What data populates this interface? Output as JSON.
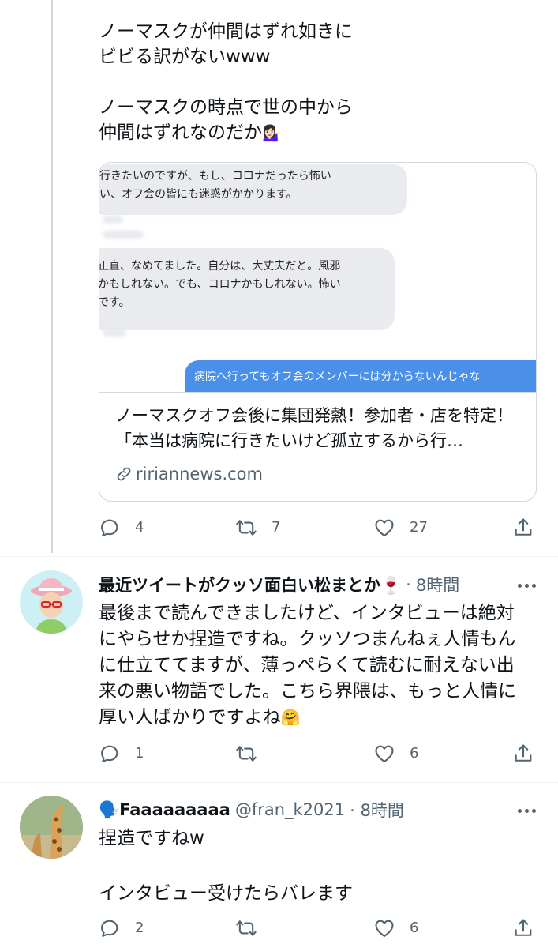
{
  "tweet1": {
    "text": "ノーマスクが仲間はずれ如きに\nビビる訳がないwww\n\nノーマスクの時点で世の中から\n仲間はずれなのだか",
    "emoji": "💁🏻‍♀️",
    "card": {
      "bubbles": [
        "行きたいのですが、もし、コロナだったら怖い\nい、オフ会の皆にも迷惑がかかります。",
        "正直、なめてました。自分は、大丈夫だと。風邪\nかもしれない。でも、コロナかもしれない。怖い\nです。",
        "病院へ行ってもオフ会のメンバーには分からないんじゃな"
      ],
      "title": "ノーマスクオフ会後に集団発熱！参加者・店を特定！「本当は病院に行きたいけど孤立するから行…",
      "domain": "ririannews.com"
    },
    "actions": {
      "reply": "4",
      "retweet": "7",
      "like": "27"
    }
  },
  "tweet2": {
    "name": "最近ツイートがクッソ面白い松まとか🍷",
    "handle": "·",
    "time": "8時間",
    "text": "最後まで読んできましたけど、インタビューは絶対にやらせか捏造ですね。クッソつまんねぇ人情もんに仕立ててますが、薄っぺらくて読むに耐えない出来の悪い物語でした。こちら界隈は、もっと人情に厚い人ばかりですよね",
    "emoji": "🤗",
    "actions": {
      "reply": "1",
      "retweet": "",
      "like": "6"
    }
  },
  "tweet3": {
    "name": "🗣️Faaaaaaaaa",
    "handle": "@fran_k2021",
    "time": "· 8時間",
    "text": "捏造ですねw\n\nインタビュー受けたらバレます",
    "actions": {
      "reply": "2",
      "retweet": "",
      "like": "6"
    }
  },
  "colors": {
    "text": "#0f1419",
    "secondary": "#536471",
    "border": "#cfd9de",
    "bubble_blue": "#4a8fe8"
  },
  "icons": [
    "reply-icon",
    "retweet-icon",
    "like-icon",
    "share-icon",
    "link-icon",
    "more-icon"
  ]
}
